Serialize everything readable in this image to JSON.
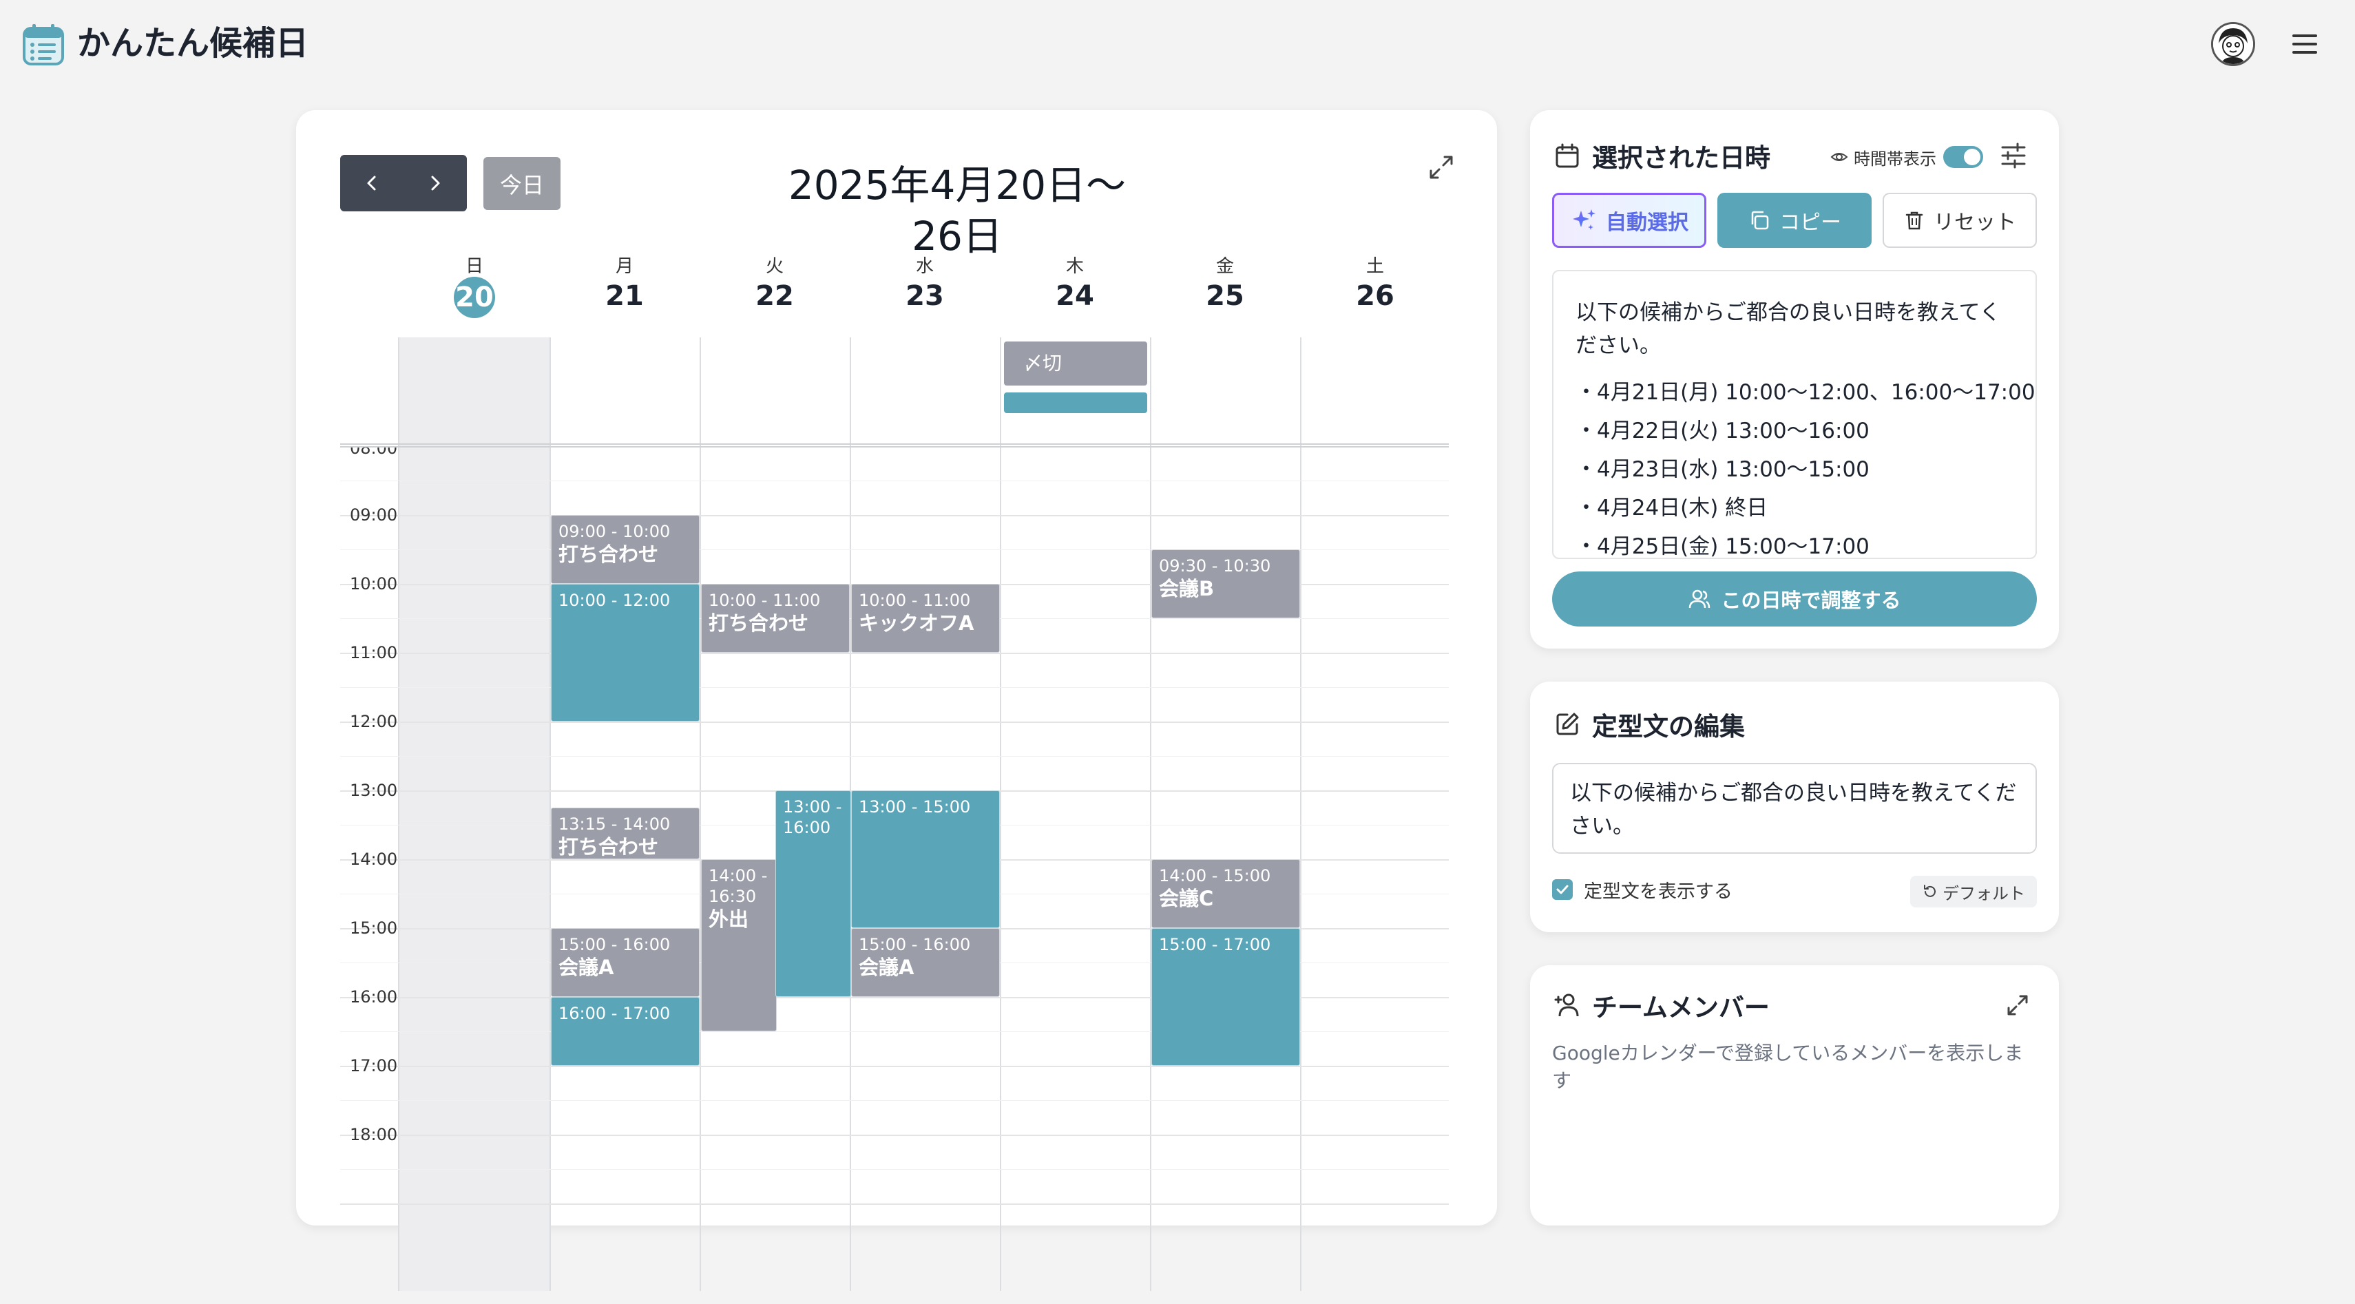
{
  "app": {
    "title": "かんたん候補日"
  },
  "calendar": {
    "week_title": "2025年4月20日〜26日",
    "today_label": "今日",
    "days": [
      {
        "dow": "日",
        "date": "20"
      },
      {
        "dow": "月",
        "date": "21"
      },
      {
        "dow": "火",
        "date": "22"
      },
      {
        "dow": "水",
        "date": "23"
      },
      {
        "dow": "木",
        "date": "24"
      },
      {
        "dow": "金",
        "date": "25"
      },
      {
        "dow": "土",
        "date": "26"
      }
    ],
    "time_labels": [
      "08:00",
      "09:00",
      "10:00",
      "11:00",
      "12:00",
      "13:00",
      "14:00",
      "15:00",
      "16:00",
      "17:00",
      "18:00"
    ],
    "allday_events": [
      {
        "day": "木 24",
        "title": "〆切",
        "kind": "gray"
      },
      {
        "day": "木 24",
        "title": "",
        "kind": "teal"
      }
    ],
    "events": [
      {
        "day": "月",
        "time": "09:00 - 10:00",
        "title": "打ち合わせ",
        "kind": "gray"
      },
      {
        "day": "月",
        "time": "10:00 - 12:00",
        "title": "",
        "kind": "selected"
      },
      {
        "day": "月",
        "time": "13:15 - 14:00",
        "title": "打ち合わせ",
        "kind": "gray"
      },
      {
        "day": "月",
        "time": "15:00 - 16:00",
        "title": "会議A",
        "kind": "gray"
      },
      {
        "day": "月",
        "time": "16:00 - 17:00",
        "title": "",
        "kind": "selected"
      },
      {
        "day": "火",
        "time": "10:00 - 11:00",
        "title": "打ち合わせ",
        "kind": "gray"
      },
      {
        "day": "火",
        "time": "14:00 - 16:30",
        "title": "外出",
        "kind": "gray"
      },
      {
        "day": "火",
        "time": "13:00 - 16:00",
        "title": "",
        "kind": "selected"
      },
      {
        "day": "水",
        "time": "10:00 - 11:00",
        "title": "キックオフA",
        "kind": "gray"
      },
      {
        "day": "水",
        "time": "13:00 - 15:00",
        "title": "",
        "kind": "selected"
      },
      {
        "day": "水",
        "time": "15:00 - 16:00",
        "title": "会議A",
        "kind": "gray"
      },
      {
        "day": "金",
        "time": "09:30 - 10:30",
        "title": "会議B",
        "kind": "gray"
      },
      {
        "day": "金",
        "time": "14:00 - 15:00",
        "title": "会議C",
        "kind": "gray"
      },
      {
        "day": "金",
        "time": "15:00 - 17:00",
        "title": "",
        "kind": "selected"
      }
    ]
  },
  "selected": {
    "title": "選択された日時",
    "timezone_toggle_label": "時間帯表示",
    "timezone_toggle_on": true,
    "auto_button": "自動選択",
    "copy_button": "コピー",
    "reset_button": "リセット",
    "result_intro": "以下の候補からご都合の良い日時を教えてください。",
    "result_lines": [
      "・4月21日(月) 10:00〜12:00、16:00〜17:00",
      "・4月22日(火) 13:00〜16:00",
      "・4月23日(水) 13:00〜15:00",
      "・4月24日(木) 終日",
      "・4月25日(金) 15:00〜17:00"
    ],
    "adjust_button": "この日時で調整する"
  },
  "template": {
    "title": "定型文の編集",
    "text": "以下の候補からご都合の良い日時を教えてください。",
    "show_checkbox_label": "定型文を表示する",
    "show_checked": true,
    "default_button": "デフォルト"
  },
  "team": {
    "title": "チームメンバー",
    "description": "Googleカレンダーで登録しているメンバーを表示します"
  },
  "colors": {
    "accent": "#5aa5b8",
    "busy": "#9b9ea8",
    "nav": "#414854",
    "auto_border": "#8b5cf6"
  },
  "icons": {
    "logo": "calendar-list-icon",
    "menu": "hamburger-icon",
    "prev": "chevron-left-icon",
    "next": "chevron-right-icon",
    "expand": "expand-icon",
    "eye": "eye-icon",
    "settings": "sliders-icon",
    "auto": "sparkles-icon",
    "copy": "copy-icon",
    "reset": "trash-icon",
    "adjust": "users-icon",
    "edit": "edit-icon",
    "default": "rotate-ccw-icon",
    "team": "user-plus-icon"
  }
}
